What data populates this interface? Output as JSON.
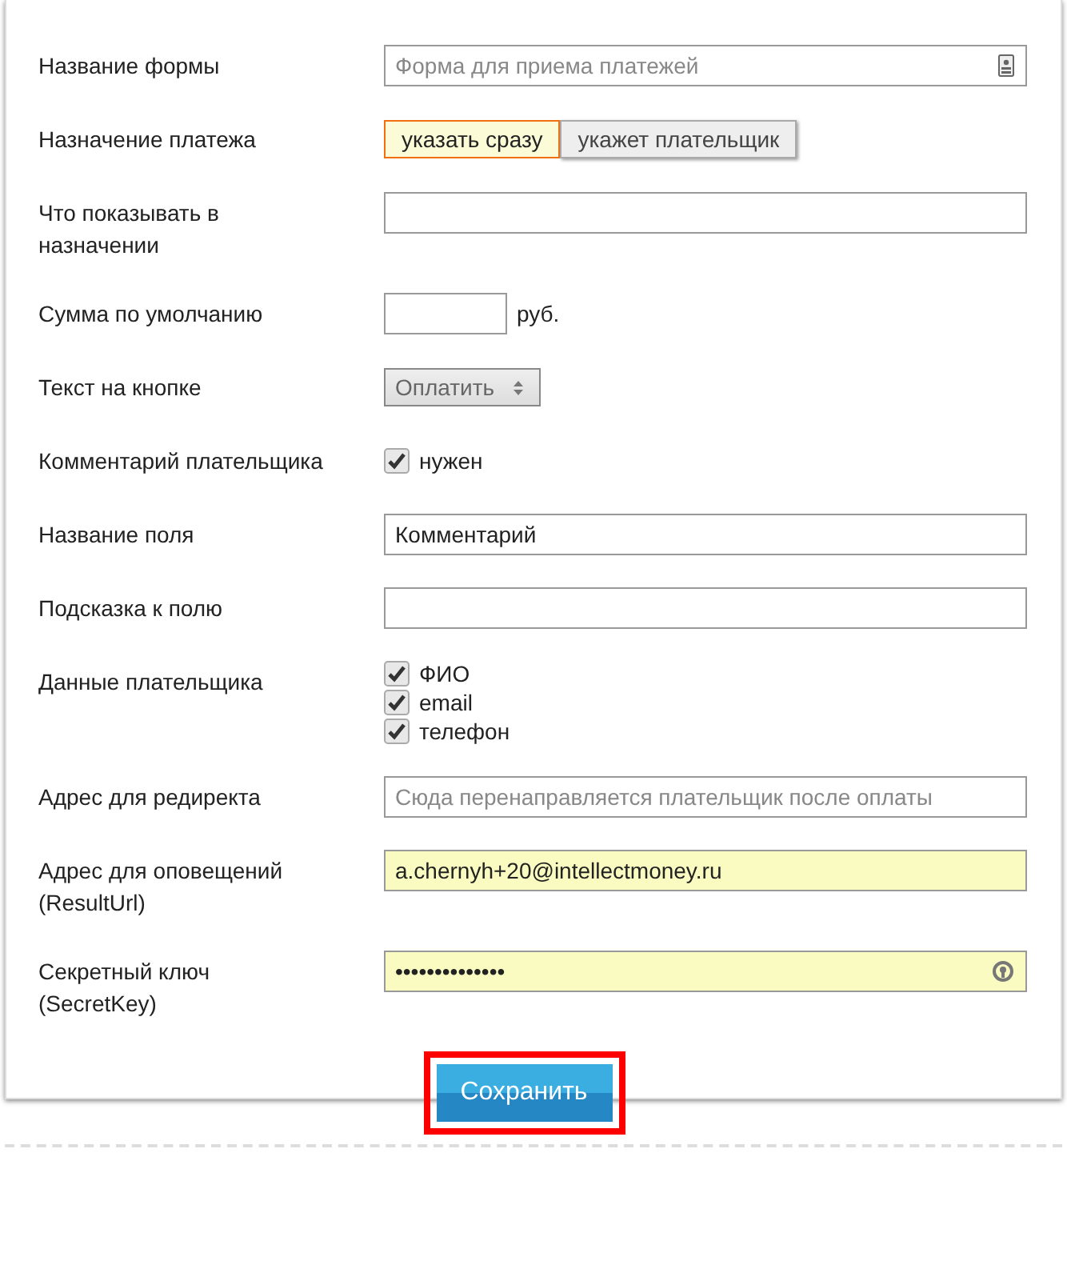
{
  "fields": [
    {
      "kind": "text",
      "label": "Название формы",
      "placeholder": "Форма для приема платежей"
    },
    {
      "kind": "toggle",
      "label": "Назначение платежа",
      "options": [
        {
          "label": "указать сразу",
          "selected": true
        },
        {
          "label": "укажет плательщик",
          "selected": false
        }
      ]
    },
    {
      "kind": "text",
      "label": "Что показывать в\nназначении"
    },
    {
      "kind": "amount",
      "label": "Сумма по умолчанию",
      "unit": "руб."
    },
    {
      "kind": "select",
      "label": "Текст на кнопке",
      "value": "Оплатить"
    },
    {
      "kind": "checkbox",
      "label": "Комментарий плательщика",
      "options": [
        {
          "label": "нужен",
          "checked": true
        }
      ]
    },
    {
      "kind": "text",
      "label": "Название поля",
      "value": "Комментарий"
    },
    {
      "kind": "text",
      "label": "Подсказка к полю"
    },
    {
      "kind": "checkbox",
      "label": "Данные плательщика",
      "options": [
        {
          "label": "ФИО",
          "checked": true
        },
        {
          "label": "email",
          "checked": true
        },
        {
          "label": "телефон",
          "checked": true
        }
      ]
    },
    {
      "kind": "text",
      "label": "Адрес для редиректа",
      "placeholder": "Сюда перенаправляется плательщик после оплаты"
    },
    {
      "kind": "text",
      "label": "Адрес для оповещений\n(ResultUrl)",
      "value": "a.chernyh+20@intellectmoney.ru",
      "autofilled": true
    },
    {
      "kind": "password",
      "label": "Секретный ключ\n(SecretKey)",
      "value": "••••••••••••••",
      "autofilled": true
    }
  ],
  "save_button": {
    "label": "Сохранить",
    "highlighted": true
  }
}
